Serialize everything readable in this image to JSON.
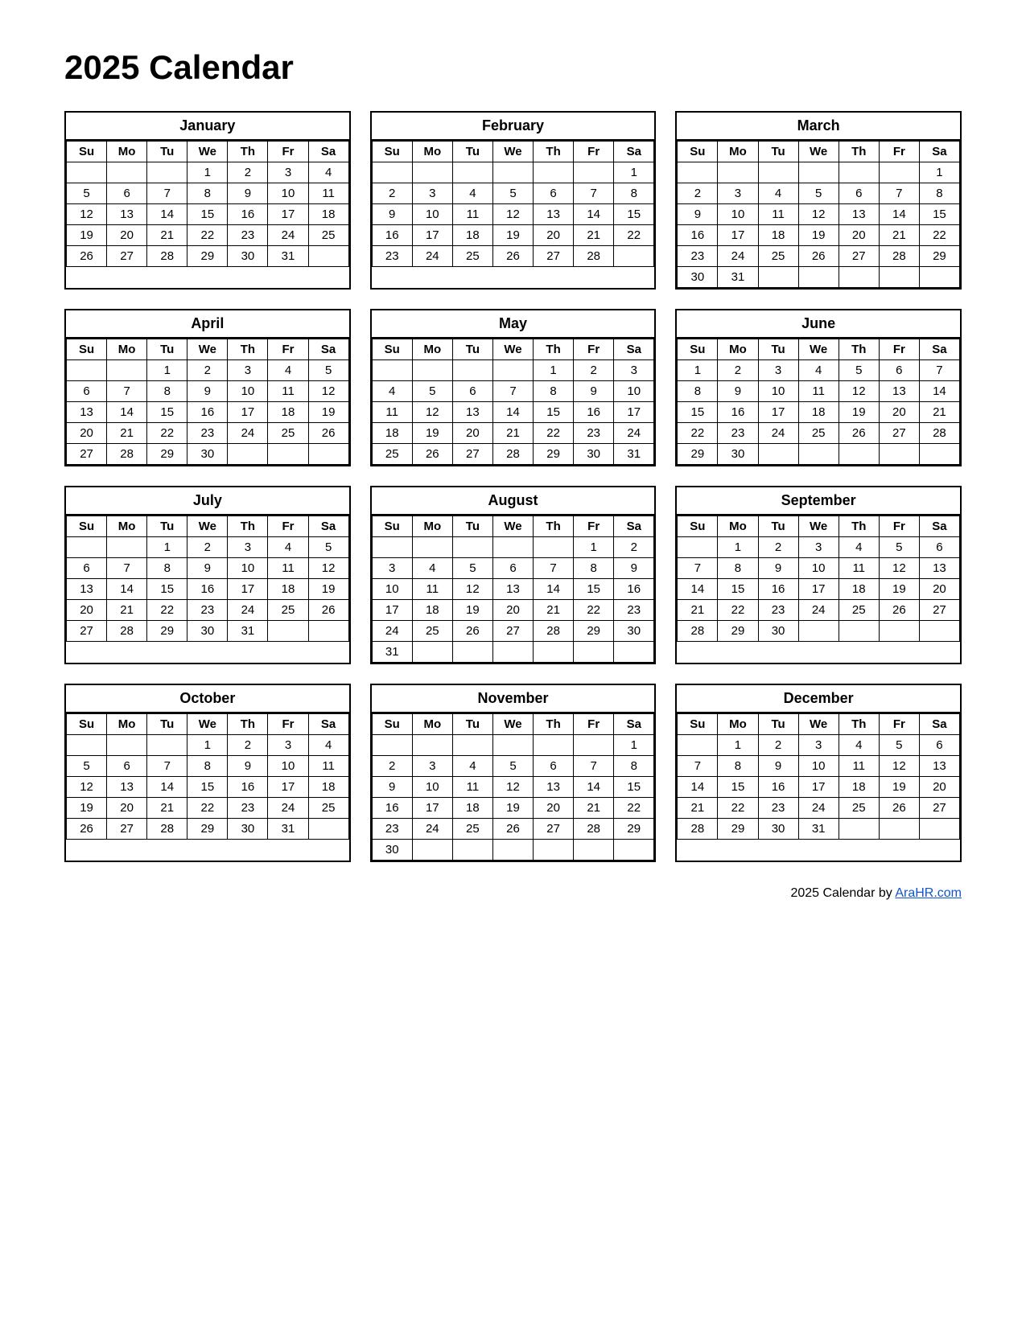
{
  "title": "2025 Calendar",
  "footer": {
    "text": "2025  Calendar by ",
    "link_text": "AraHR.com",
    "link_url": "AraHR.com"
  },
  "months": [
    {
      "name": "January",
      "days_header": [
        "Su",
        "Mo",
        "Tu",
        "We",
        "Th",
        "Fr",
        "Sa"
      ],
      "weeks": [
        [
          "",
          "",
          "",
          "1",
          "2",
          "3",
          "4"
        ],
        [
          "5",
          "6",
          "7",
          "8",
          "9",
          "10",
          "11"
        ],
        [
          "12",
          "13",
          "14",
          "15",
          "16",
          "17",
          "18"
        ],
        [
          "19",
          "20",
          "21",
          "22",
          "23",
          "24",
          "25"
        ],
        [
          "26",
          "27",
          "28",
          "29",
          "30",
          "31",
          ""
        ],
        [
          "",
          "",
          "",
          "",
          "",
          "",
          ""
        ]
      ]
    },
    {
      "name": "February",
      "days_header": [
        "Su",
        "Mo",
        "Tu",
        "We",
        "Th",
        "Fr",
        "Sa"
      ],
      "weeks": [
        [
          "",
          "",
          "",
          "",
          "",
          "",
          "1"
        ],
        [
          "2",
          "3",
          "4",
          "5",
          "6",
          "7",
          "8"
        ],
        [
          "9",
          "10",
          "11",
          "12",
          "13",
          "14",
          "15"
        ],
        [
          "16",
          "17",
          "18",
          "19",
          "20",
          "21",
          "22"
        ],
        [
          "23",
          "24",
          "25",
          "26",
          "27",
          "28",
          ""
        ],
        [
          "",
          "",
          "",
          "",
          "",
          "",
          ""
        ]
      ]
    },
    {
      "name": "March",
      "days_header": [
        "Su",
        "Mo",
        "Tu",
        "We",
        "Th",
        "Fr",
        "Sa"
      ],
      "weeks": [
        [
          "",
          "",
          "",
          "",
          "",
          "",
          "1"
        ],
        [
          "2",
          "3",
          "4",
          "5",
          "6",
          "7",
          "8"
        ],
        [
          "9",
          "10",
          "11",
          "12",
          "13",
          "14",
          "15"
        ],
        [
          "16",
          "17",
          "18",
          "19",
          "20",
          "21",
          "22"
        ],
        [
          "23",
          "24",
          "25",
          "26",
          "27",
          "28",
          "29"
        ],
        [
          "30",
          "31",
          "",
          "",
          "",
          "",
          ""
        ]
      ]
    },
    {
      "name": "April",
      "days_header": [
        "Su",
        "Mo",
        "Tu",
        "We",
        "Th",
        "Fr",
        "Sa"
      ],
      "weeks": [
        [
          "",
          "",
          "1",
          "2",
          "3",
          "4",
          "5"
        ],
        [
          "6",
          "7",
          "8",
          "9",
          "10",
          "11",
          "12"
        ],
        [
          "13",
          "14",
          "15",
          "16",
          "17",
          "18",
          "19"
        ],
        [
          "20",
          "21",
          "22",
          "23",
          "24",
          "25",
          "26"
        ],
        [
          "27",
          "28",
          "29",
          "30",
          "",
          "",
          ""
        ],
        [
          "",
          "",
          "",
          "",
          "",
          "",
          ""
        ]
      ]
    },
    {
      "name": "May",
      "days_header": [
        "Su",
        "Mo",
        "Tu",
        "We",
        "Th",
        "Fr",
        "Sa"
      ],
      "weeks": [
        [
          "",
          "",
          "",
          "",
          "1",
          "2",
          "3"
        ],
        [
          "4",
          "5",
          "6",
          "7",
          "8",
          "9",
          "10"
        ],
        [
          "11",
          "12",
          "13",
          "14",
          "15",
          "16",
          "17"
        ],
        [
          "18",
          "19",
          "20",
          "21",
          "22",
          "23",
          "24"
        ],
        [
          "25",
          "26",
          "27",
          "28",
          "29",
          "30",
          "31"
        ],
        [
          "",
          "",
          "",
          "",
          "",
          "",
          ""
        ]
      ]
    },
    {
      "name": "June",
      "days_header": [
        "Su",
        "Mo",
        "Tu",
        "We",
        "Th",
        "Fr",
        "Sa"
      ],
      "weeks": [
        [
          "1",
          "2",
          "3",
          "4",
          "5",
          "6",
          "7"
        ],
        [
          "8",
          "9",
          "10",
          "11",
          "12",
          "13",
          "14"
        ],
        [
          "15",
          "16",
          "17",
          "18",
          "19",
          "20",
          "21"
        ],
        [
          "22",
          "23",
          "24",
          "25",
          "26",
          "27",
          "28"
        ],
        [
          "29",
          "30",
          "",
          "",
          "",
          "",
          ""
        ],
        [
          "",
          "",
          "",
          "",
          "",
          "",
          ""
        ]
      ]
    },
    {
      "name": "July",
      "days_header": [
        "Su",
        "Mo",
        "Tu",
        "We",
        "Th",
        "Fr",
        "Sa"
      ],
      "weeks": [
        [
          "",
          "",
          "1",
          "2",
          "3",
          "4",
          "5"
        ],
        [
          "6",
          "7",
          "8",
          "9",
          "10",
          "11",
          "12"
        ],
        [
          "13",
          "14",
          "15",
          "16",
          "17",
          "18",
          "19"
        ],
        [
          "20",
          "21",
          "22",
          "23",
          "24",
          "25",
          "26"
        ],
        [
          "27",
          "28",
          "29",
          "30",
          "31",
          "",
          ""
        ],
        [
          "",
          "",
          "",
          "",
          "",
          "",
          ""
        ]
      ]
    },
    {
      "name": "August",
      "days_header": [
        "Su",
        "Mo",
        "Tu",
        "We",
        "Th",
        "Fr",
        "Sa"
      ],
      "weeks": [
        [
          "",
          "",
          "",
          "",
          "",
          "1",
          "2"
        ],
        [
          "3",
          "4",
          "5",
          "6",
          "7",
          "8",
          "9"
        ],
        [
          "10",
          "11",
          "12",
          "13",
          "14",
          "15",
          "16"
        ],
        [
          "17",
          "18",
          "19",
          "20",
          "21",
          "22",
          "23"
        ],
        [
          "24",
          "25",
          "26",
          "27",
          "28",
          "29",
          "30"
        ],
        [
          "31",
          "",
          "",
          "",
          "",
          "",
          ""
        ]
      ]
    },
    {
      "name": "September",
      "days_header": [
        "Su",
        "Mo",
        "Tu",
        "We",
        "Th",
        "Fr",
        "Sa"
      ],
      "weeks": [
        [
          "",
          "1",
          "2",
          "3",
          "4",
          "5",
          "6"
        ],
        [
          "7",
          "8",
          "9",
          "10",
          "11",
          "12",
          "13"
        ],
        [
          "14",
          "15",
          "16",
          "17",
          "18",
          "19",
          "20"
        ],
        [
          "21",
          "22",
          "23",
          "24",
          "25",
          "26",
          "27"
        ],
        [
          "28",
          "29",
          "30",
          "",
          "",
          "",
          ""
        ],
        [
          "",
          "",
          "",
          "",
          "",
          "",
          ""
        ]
      ]
    },
    {
      "name": "October",
      "days_header": [
        "Su",
        "Mo",
        "Tu",
        "We",
        "Th",
        "Fr",
        "Sa"
      ],
      "weeks": [
        [
          "",
          "",
          "",
          "1",
          "2",
          "3",
          "4"
        ],
        [
          "5",
          "6",
          "7",
          "8",
          "9",
          "10",
          "11"
        ],
        [
          "12",
          "13",
          "14",
          "15",
          "16",
          "17",
          "18"
        ],
        [
          "19",
          "20",
          "21",
          "22",
          "23",
          "24",
          "25"
        ],
        [
          "26",
          "27",
          "28",
          "29",
          "30",
          "31",
          ""
        ],
        [
          "",
          "",
          "",
          "",
          "",
          "",
          ""
        ]
      ]
    },
    {
      "name": "November",
      "days_header": [
        "Su",
        "Mo",
        "Tu",
        "We",
        "Th",
        "Fr",
        "Sa"
      ],
      "weeks": [
        [
          "",
          "",
          "",
          "",
          "",
          "",
          "1"
        ],
        [
          "2",
          "3",
          "4",
          "5",
          "6",
          "7",
          "8"
        ],
        [
          "9",
          "10",
          "11",
          "12",
          "13",
          "14",
          "15"
        ],
        [
          "16",
          "17",
          "18",
          "19",
          "20",
          "21",
          "22"
        ],
        [
          "23",
          "24",
          "25",
          "26",
          "27",
          "28",
          "29"
        ],
        [
          "30",
          "",
          "",
          "",
          "",
          "",
          ""
        ]
      ]
    },
    {
      "name": "December",
      "days_header": [
        "Su",
        "Mo",
        "Tu",
        "We",
        "Th",
        "Fr",
        "Sa"
      ],
      "weeks": [
        [
          "",
          "1",
          "2",
          "3",
          "4",
          "5",
          "6"
        ],
        [
          "7",
          "8",
          "9",
          "10",
          "11",
          "12",
          "13"
        ],
        [
          "14",
          "15",
          "16",
          "17",
          "18",
          "19",
          "20"
        ],
        [
          "21",
          "22",
          "23",
          "24",
          "25",
          "26",
          "27"
        ],
        [
          "28",
          "29",
          "30",
          "31",
          "",
          "",
          ""
        ],
        [
          "",
          "",
          "",
          "",
          "",
          "",
          ""
        ]
      ]
    }
  ]
}
